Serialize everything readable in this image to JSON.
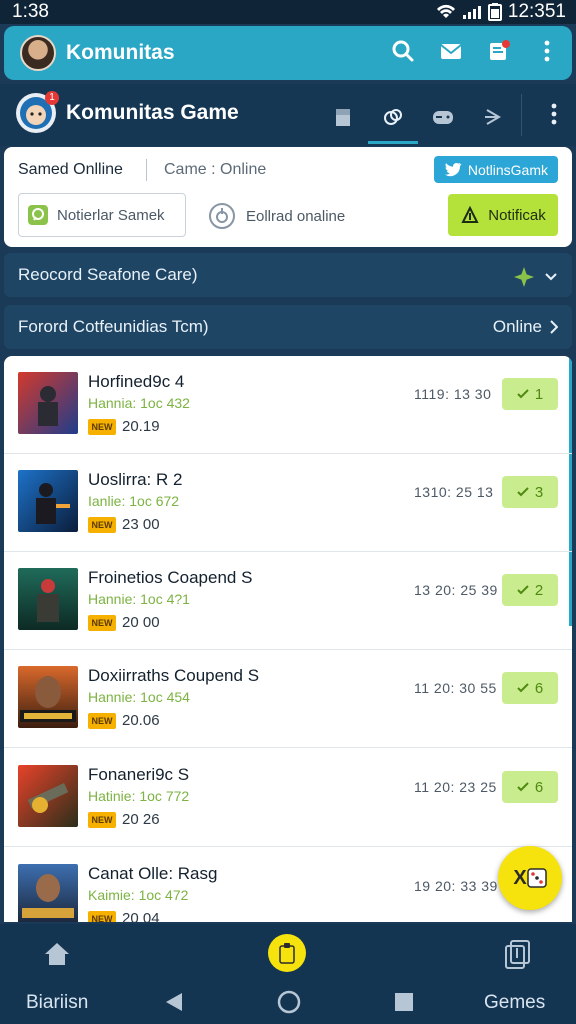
{
  "status_bar": {
    "time_left": "1:38",
    "time_right": "12:351"
  },
  "app_bar": {
    "title": "Komunitas"
  },
  "sub_header": {
    "title": "Komunitas Game",
    "badge": "1"
  },
  "filter_card": {
    "label_left": "Samed Onlline",
    "label_right": "Came  :  Online",
    "twitter_button": "NotlinsGamk",
    "input_value": "Notierlar Samek",
    "option_label": "Eollrad onaline",
    "notify_button": "Notificak"
  },
  "bar_one": {
    "label": "Reocord Seafone Care)"
  },
  "bar_two": {
    "label": "Forord Cotfeunidias Tcm)",
    "right": "Online"
  },
  "list": {
    "items": [
      {
        "name": "Horfined9c 4",
        "sub": "Hannia: 1oc 432",
        "tag": "NEW",
        "num": "20.19",
        "time": "1119: 13 30",
        "count": "1"
      },
      {
        "name": "Uoslirra: R 2",
        "sub": "Ianlie: 1oc 672",
        "tag": "NEW",
        "num": "23 00",
        "time": "1310: 25 13",
        "count": "3"
      },
      {
        "name": "Froinetios Coapend S",
        "sub": "Hannie: 1oc 4?1",
        "tag": "NEW",
        "num": "20 00",
        "time": "13 20: 25 39",
        "count": "2"
      },
      {
        "name": "Doxiirraths Coupend S",
        "sub": "Hannie: 1oc 454",
        "tag": "NEW",
        "num": "20.06",
        "time": "11 20: 30 55",
        "count": "6"
      },
      {
        "name": "Fonaneri9c S",
        "sub": "Hatinie: 1oc 772",
        "tag": "NEW",
        "num": "20 26",
        "time": "11 20: 23 25",
        "count": "6"
      },
      {
        "name": "Canat Olle: Rasg",
        "sub": "Kaimie: 1oc 472",
        "tag": "NEW",
        "num": "20 04",
        "time": "19 20: 33 39",
        "count": ""
      }
    ]
  },
  "fab": {
    "label": "X"
  },
  "bottom_nav": {
    "left_label": "Biariisn",
    "right_label": "Gemes"
  },
  "colors": {
    "accent": "#2aa7c5",
    "lime": "#b5e23a",
    "navy": "#163754",
    "yellow": "#f6e20c"
  }
}
